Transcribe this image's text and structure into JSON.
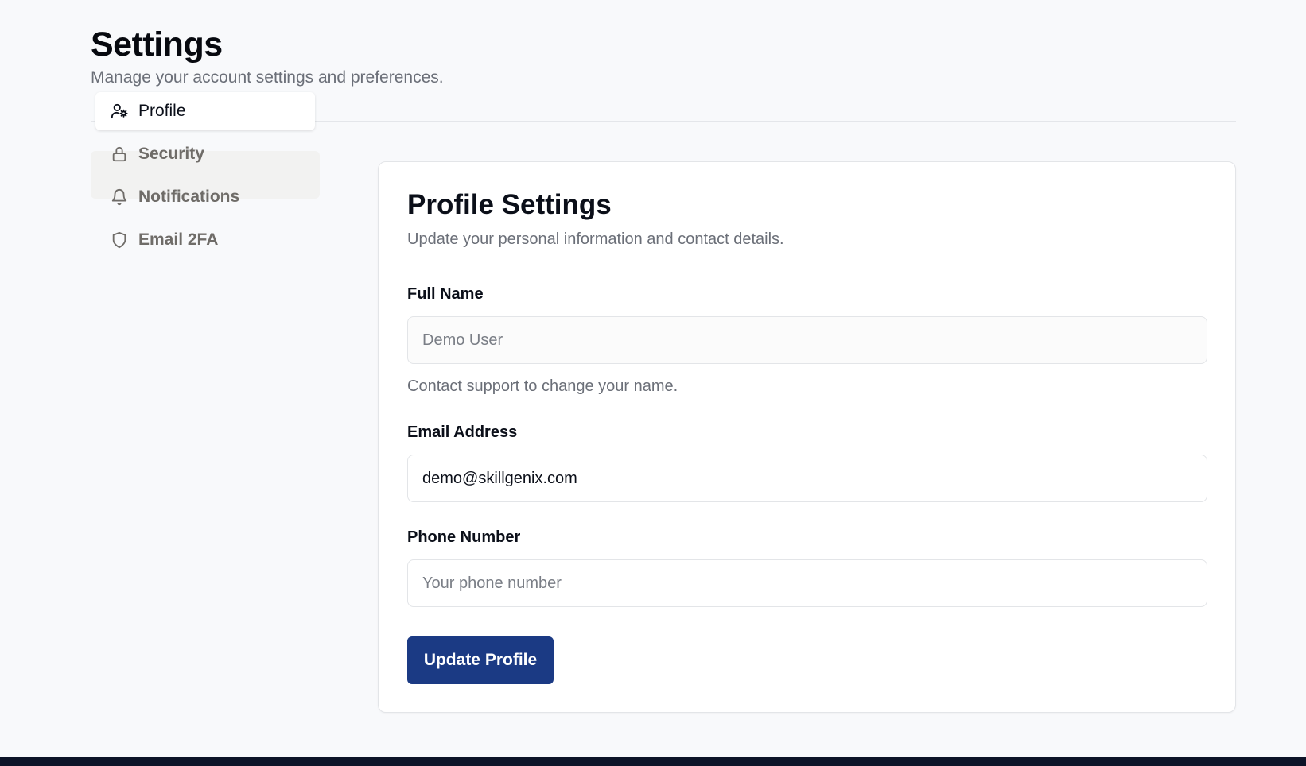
{
  "page": {
    "title": "Settings",
    "subtitle": "Manage your account settings and preferences."
  },
  "sidebar": {
    "items": [
      {
        "label": "Profile",
        "icon": "user-cog-icon",
        "active": true
      },
      {
        "label": "Security",
        "icon": "lock-icon",
        "active": false
      },
      {
        "label": "Notifications",
        "icon": "bell-icon",
        "active": false
      },
      {
        "label": "Email 2FA",
        "icon": "shield-icon",
        "active": false
      }
    ]
  },
  "profile": {
    "title": "Profile Settings",
    "subtitle": "Update your personal information and contact details.",
    "full_name": {
      "label": "Full Name",
      "value": "",
      "placeholder": "Demo User",
      "helper": "Contact support to change your name."
    },
    "email": {
      "label": "Email Address",
      "value": "demo@skillgenix.com",
      "placeholder": ""
    },
    "phone": {
      "label": "Phone Number",
      "value": "",
      "placeholder": "Your phone number"
    },
    "submit_label": "Update Profile"
  },
  "colors": {
    "accent": "#1b3a84",
    "background": "#f8f9fb",
    "footer": "#0d1428"
  }
}
